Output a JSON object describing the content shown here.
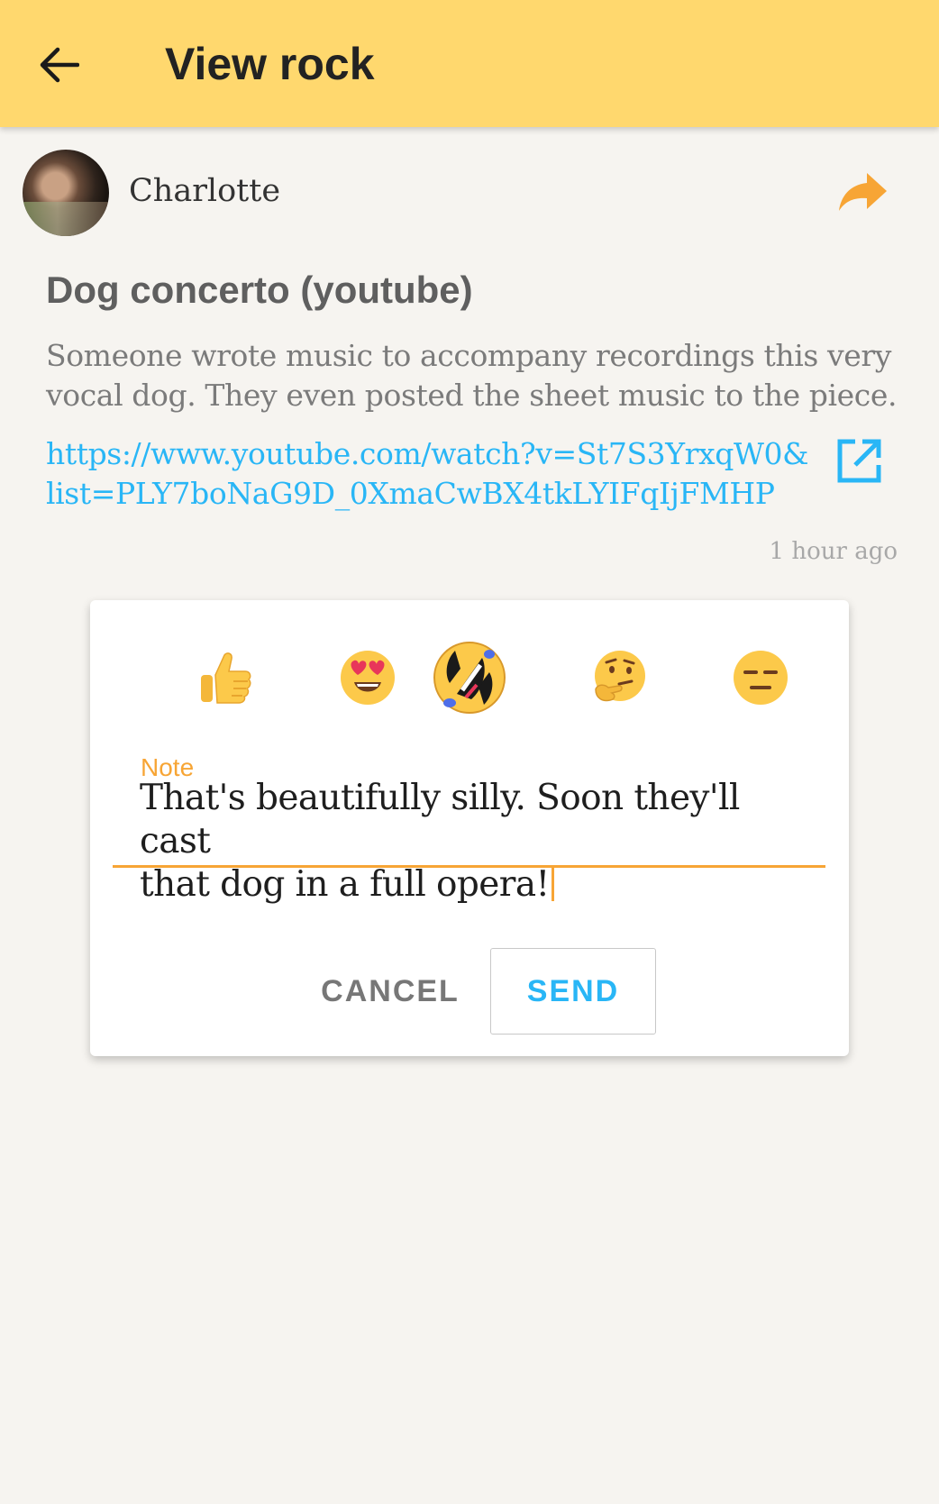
{
  "appbar": {
    "title": "View rock",
    "back_icon": "arrow-left-icon",
    "color": "#ffd86e"
  },
  "author": {
    "name": "Charlotte",
    "share_icon": "share-arrow-icon"
  },
  "rock": {
    "title": "Dog concerto (youtube)",
    "description": "Someone wrote music to accompany recordings this very vocal dog. They even posted the sheet music to the piece.",
    "link_line1": "https://www.youtube.com/watch?v=St7S3YrxqW0&",
    "link_line2": "list=PLY7boNaG9D_0XmaCwBX4tkLYIFqIjFMHP",
    "open_link_icon": "open-in-new-icon",
    "timestamp": "1 hour ago"
  },
  "reaction_dialog": {
    "reactions": [
      {
        "name": "thumbs-up",
        "glyph": "👍"
      },
      {
        "name": "heart-eyes",
        "glyph": "😍"
      },
      {
        "name": "rolling-on-floor-laughing",
        "glyph": "🤣",
        "selected": true
      },
      {
        "name": "thinking",
        "glyph": "🤔"
      },
      {
        "name": "expressionless",
        "glyph": "😑"
      }
    ],
    "note_label": "Note",
    "note_line1": "That's beautifully silly. Soon they'll cast",
    "note_line2": "that dog in a full opera!",
    "cancel_label": "CANCEL",
    "send_label": "SEND"
  },
  "colors": {
    "accent": "#f7a535",
    "link": "#29b6f6",
    "background": "#f6f4f0"
  }
}
